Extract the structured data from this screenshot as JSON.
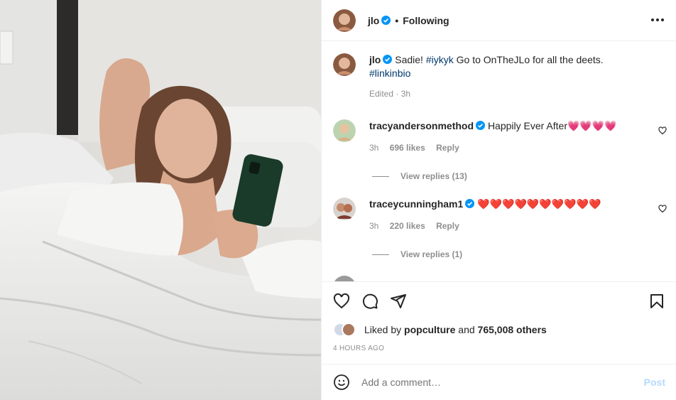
{
  "post": {
    "username": "jlo",
    "separator": "•",
    "follow_status": "Following",
    "caption_user": "jlo",
    "caption_text": "Sadie!",
    "caption_hashtag1": "#iykyk",
    "caption_text2": "Go to OnTheJLo for all the deets.",
    "caption_hashtag2": "#linkinbio",
    "caption_meta": "Edited · 3h"
  },
  "comments": [
    {
      "username": "tracyandersonmethod",
      "text": "Happily Ever After💗💗💗💗",
      "time": "3h",
      "likes": "696 likes",
      "reply": "Reply",
      "view_replies": "View replies (13)"
    },
    {
      "username": "traceycunningham1",
      "text": "❤️❤️❤️❤️❤️❤️❤️❤️❤️❤️",
      "time": "3h",
      "likes": "220 likes",
      "reply": "Reply",
      "view_replies": "View replies (1)"
    }
  ],
  "likes": {
    "prefix": "Liked by",
    "user": "popculture",
    "mid": "and",
    "count": "765,008 others"
  },
  "timestamp": "4 HOURS AGO",
  "add_comment": {
    "placeholder": "Add a comment…",
    "post_label": "Post"
  },
  "icons": [
    "more-options-icon",
    "verified-icon",
    "heart-icon",
    "comment-icon",
    "share-icon",
    "save-icon",
    "emoji-icon"
  ],
  "colors": {
    "verified": "#0095f6",
    "hashtag": "#00376b",
    "post_disabled": "#b3dbff",
    "muted": "#8e8e8e"
  }
}
